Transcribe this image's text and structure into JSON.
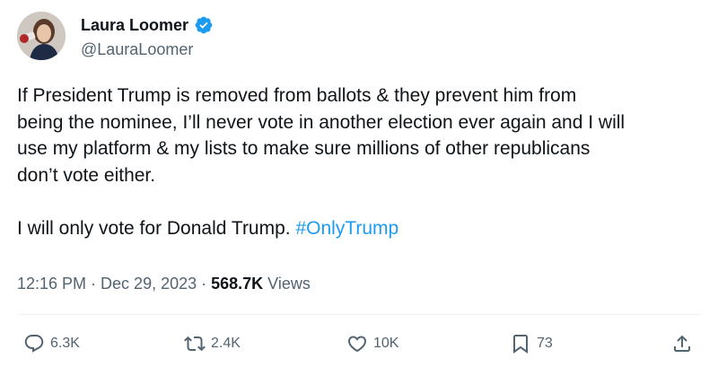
{
  "author": {
    "display_name": "Laura Loomer",
    "handle": "@LauraLoomer",
    "verified_icon": "verified-badge-icon",
    "badge_color": "#1d9bf0"
  },
  "tweet": {
    "paragraph_1": [
      "If President Trump is removed from ballots & they prevent him from",
      "being the nominee, I’ll never vote in another election ever again and I will",
      "use my platform & my lists to make sure millions of other republicans",
      "don’t vote either."
    ],
    "paragraph_2_text": "I will only vote for Donald Trump. ",
    "hashtag": "#OnlyTrump",
    "hashtag_color": "#1d9bf0"
  },
  "meta": {
    "time": "12:16 PM",
    "separator_1": " · ",
    "date": "Dec 29, 2023",
    "separator_2": " · ",
    "views_count": "568.7K",
    "views_label": " Views"
  },
  "actions": {
    "reply": {
      "icon": "reply-icon",
      "count": "6.3K"
    },
    "repost": {
      "icon": "repost-icon",
      "count": "2.4K"
    },
    "like": {
      "icon": "heart-icon",
      "count": "10K"
    },
    "bookmark": {
      "icon": "bookmark-icon",
      "count": "73"
    },
    "share": {
      "icon": "share-icon"
    }
  }
}
